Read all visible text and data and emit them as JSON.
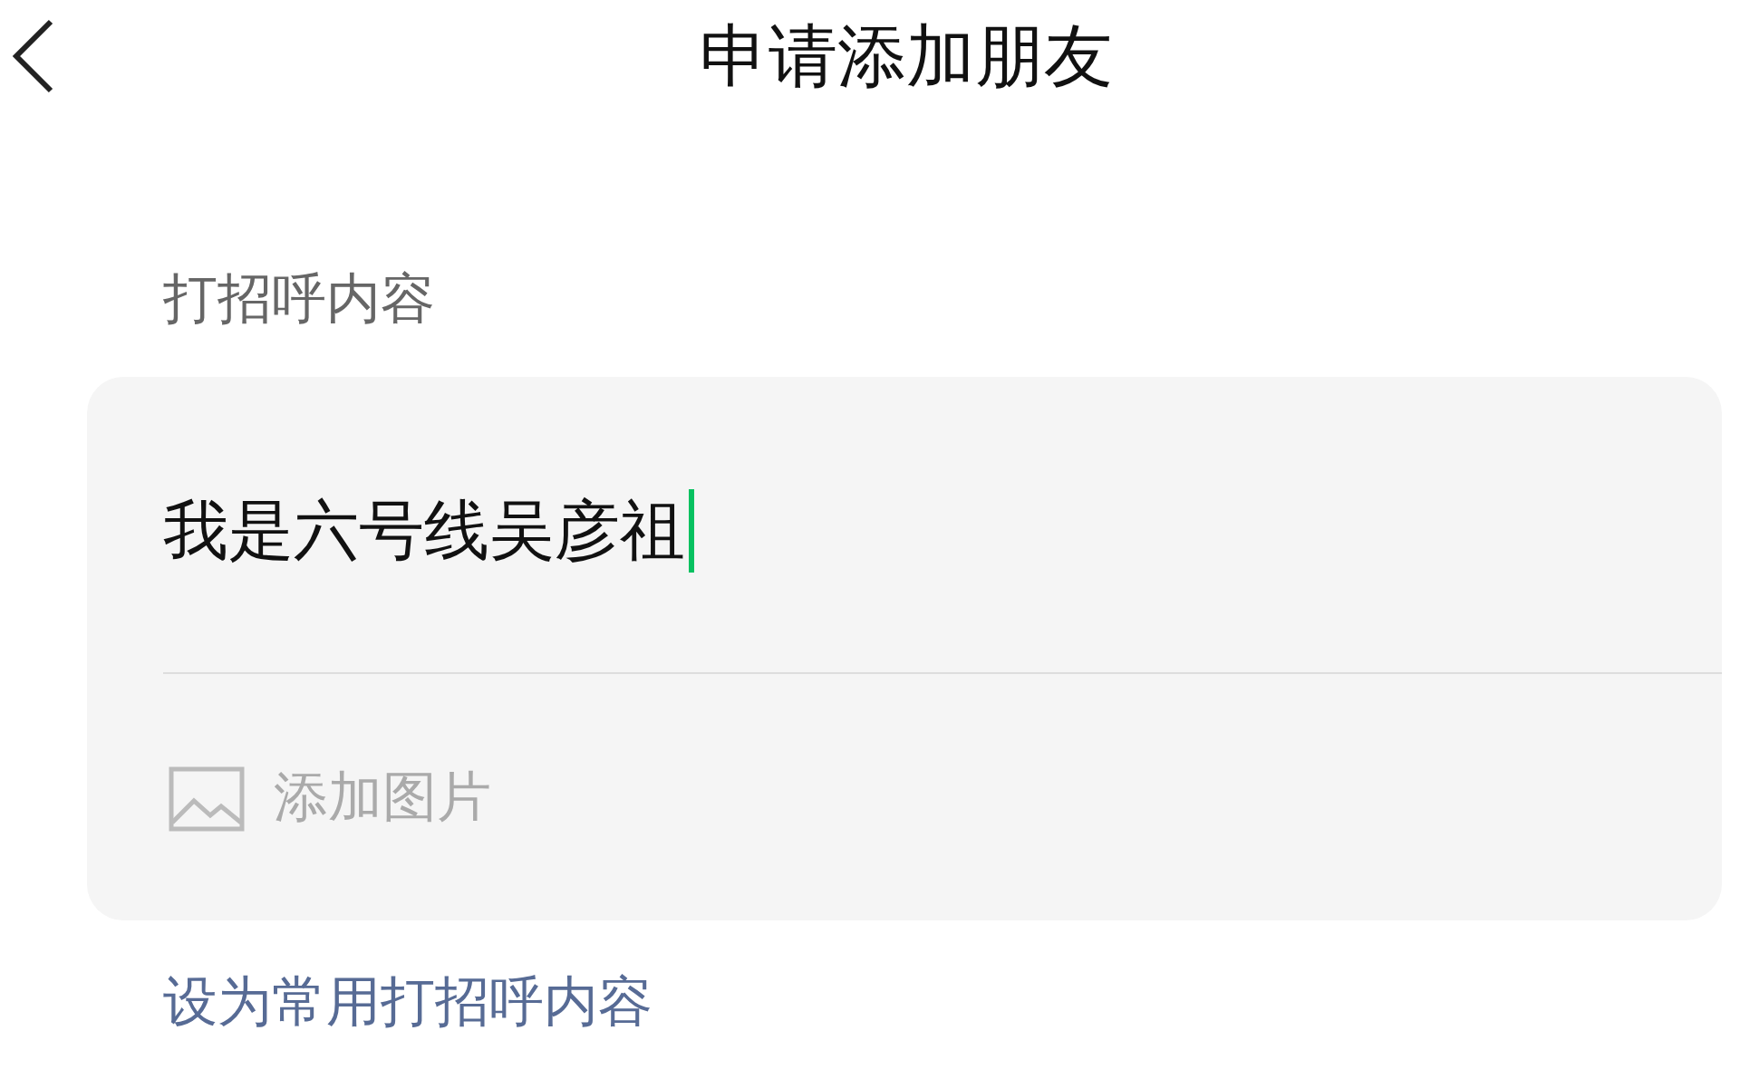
{
  "header": {
    "title": "申请添加朋友"
  },
  "greeting": {
    "label": "打招呼内容",
    "value": "我是六号线吴彦祖",
    "focused": true,
    "add_image": "添加图片"
  },
  "link": "设为常用打招呼内容"
}
